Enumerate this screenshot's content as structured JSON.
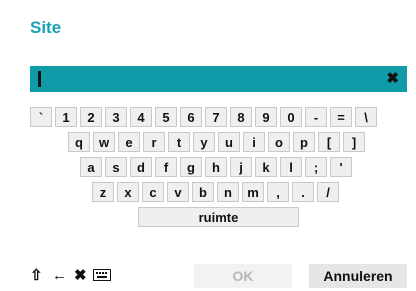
{
  "dialog": {
    "title": "Site"
  },
  "input": {
    "value": "",
    "clear_icon": "close-icon"
  },
  "keyboard": {
    "row1": [
      "`",
      "1",
      "2",
      "3",
      "4",
      "5",
      "6",
      "7",
      "8",
      "9",
      "0",
      "-",
      "=",
      "\\"
    ],
    "row2": [
      "q",
      "w",
      "e",
      "r",
      "t",
      "y",
      "u",
      "i",
      "o",
      "p",
      "[",
      "]"
    ],
    "row3": [
      "a",
      "s",
      "d",
      "f",
      "g",
      "h",
      "j",
      "k",
      "l",
      ";",
      "'"
    ],
    "row4": [
      "z",
      "x",
      "c",
      "v",
      "b",
      "n",
      "m",
      ",",
      ".",
      "/"
    ],
    "space_label": "ruimte"
  },
  "controls": {
    "shift_icon": "shift-icon",
    "backspace_icon": "backspace-icon",
    "clear_icon": "close-icon",
    "keyboard_icon": "keyboard-icon"
  },
  "buttons": {
    "ok_label": "OK",
    "cancel_label": "Annuleren"
  },
  "colors": {
    "accent": "#1aa0b8",
    "input_bg": "#0f9ba7",
    "key_bg": "#efefef"
  }
}
